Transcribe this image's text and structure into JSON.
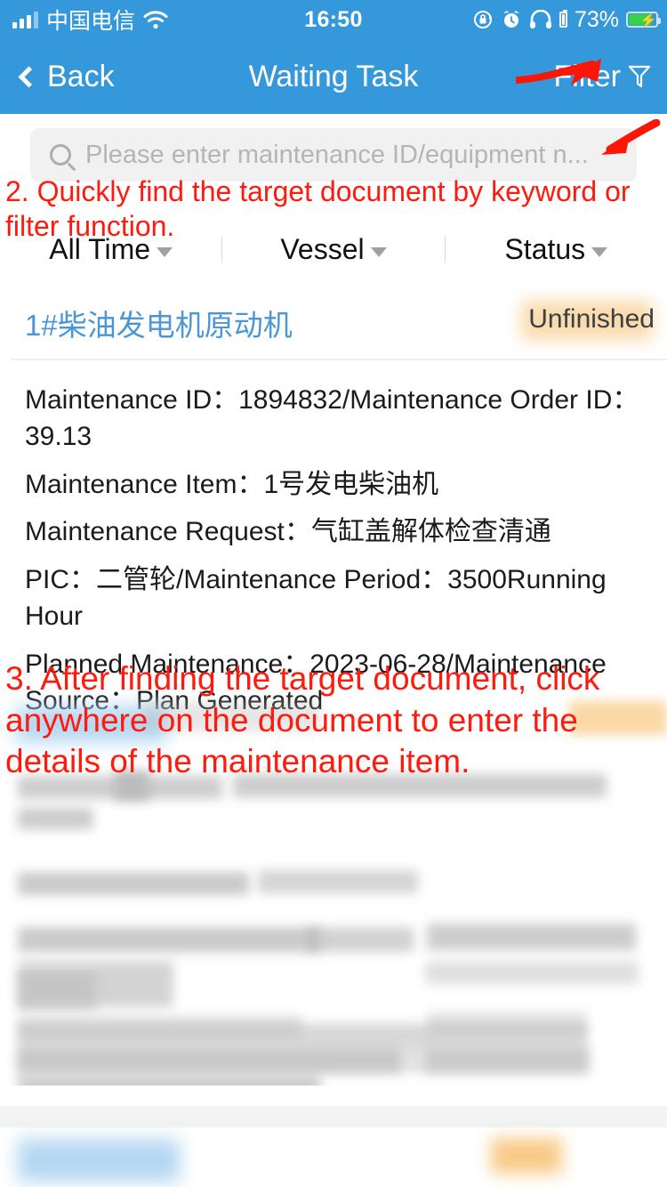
{
  "status_bar": {
    "carrier": "中国电信",
    "signal_icon": "signal-bars-icon",
    "wifi_icon": "wifi-icon",
    "time": "16:50",
    "rotation_lock_icon": "rotation-lock-icon",
    "alarm_icon": "alarm-clock-icon",
    "headphones_icon": "headphones-icon",
    "headphone_battery_icon": "headphone-battery-icon",
    "battery_percent": "73%",
    "battery_icon": "battery-charging-icon"
  },
  "nav_bar": {
    "back_label": "Back",
    "back_icon": "chevron-left-icon",
    "title": "Waiting Task",
    "filter_label": "Filter",
    "filter_icon": "funnel-icon"
  },
  "search": {
    "placeholder": "Please enter maintenance ID/equipment n...",
    "value": "",
    "icon": "search-icon"
  },
  "filters": [
    {
      "label": "All Time",
      "icon": "chevron-down-icon"
    },
    {
      "label": "Vessel",
      "icon": "chevron-down-icon"
    },
    {
      "label": "Status",
      "icon": "chevron-down-icon"
    }
  ],
  "task_card": {
    "title": "1#柴油发电机原动机",
    "status": "Unfinished",
    "lines": [
      "Maintenance ID：1894832/Maintenance Order ID：39.13",
      "Maintenance Item：1号发电柴油机",
      "Maintenance Request：气缸盖解体检查清通",
      "PIC：二管轮/Maintenance Period：3500Running Hour",
      "Planned Maintenance：2023-06-28/Maintenance Source：Plan Generated"
    ]
  },
  "annotations": [
    {
      "id": "step-2",
      "text": "2. Quickly find the target document by keyword or filter function.",
      "color": "#ff1a0d"
    },
    {
      "id": "step-3",
      "text": "3. After finding the target document, click anywhere on the document to enter the details of the maintenance item.",
      "color": "#ff1a0d"
    }
  ],
  "arrows": [
    {
      "id": "arrow-to-filter",
      "target": "filter-button",
      "color": "#fa1707"
    },
    {
      "id": "arrow-to-search",
      "target": "search-input",
      "color": "#fa1707"
    }
  ],
  "colors": {
    "header_blue": "#3498db",
    "title_blue": "#4a97d8",
    "status_badge_bg": "#f9d9a8",
    "annotation_red": "#ff1a0d",
    "search_bg": "#f1f1f1",
    "list_gap": "#f2f3f3"
  }
}
